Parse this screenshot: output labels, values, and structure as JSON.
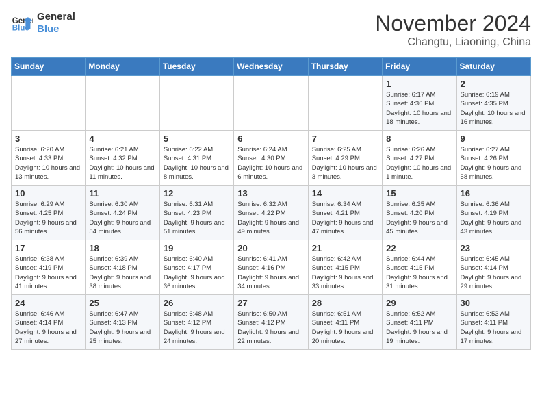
{
  "logo": {
    "line1": "General",
    "line2": "Blue"
  },
  "title": "November 2024",
  "location": "Changtu, Liaoning, China",
  "days_of_week": [
    "Sunday",
    "Monday",
    "Tuesday",
    "Wednesday",
    "Thursday",
    "Friday",
    "Saturday"
  ],
  "weeks": [
    [
      {
        "day": "",
        "info": ""
      },
      {
        "day": "",
        "info": ""
      },
      {
        "day": "",
        "info": ""
      },
      {
        "day": "",
        "info": ""
      },
      {
        "day": "",
        "info": ""
      },
      {
        "day": "1",
        "info": "Sunrise: 6:17 AM\nSunset: 4:36 PM\nDaylight: 10 hours and 18 minutes."
      },
      {
        "day": "2",
        "info": "Sunrise: 6:19 AM\nSunset: 4:35 PM\nDaylight: 10 hours and 16 minutes."
      }
    ],
    [
      {
        "day": "3",
        "info": "Sunrise: 6:20 AM\nSunset: 4:33 PM\nDaylight: 10 hours and 13 minutes."
      },
      {
        "day": "4",
        "info": "Sunrise: 6:21 AM\nSunset: 4:32 PM\nDaylight: 10 hours and 11 minutes."
      },
      {
        "day": "5",
        "info": "Sunrise: 6:22 AM\nSunset: 4:31 PM\nDaylight: 10 hours and 8 minutes."
      },
      {
        "day": "6",
        "info": "Sunrise: 6:24 AM\nSunset: 4:30 PM\nDaylight: 10 hours and 6 minutes."
      },
      {
        "day": "7",
        "info": "Sunrise: 6:25 AM\nSunset: 4:29 PM\nDaylight: 10 hours and 3 minutes."
      },
      {
        "day": "8",
        "info": "Sunrise: 6:26 AM\nSunset: 4:27 PM\nDaylight: 10 hours and 1 minute."
      },
      {
        "day": "9",
        "info": "Sunrise: 6:27 AM\nSunset: 4:26 PM\nDaylight: 9 hours and 58 minutes."
      }
    ],
    [
      {
        "day": "10",
        "info": "Sunrise: 6:29 AM\nSunset: 4:25 PM\nDaylight: 9 hours and 56 minutes."
      },
      {
        "day": "11",
        "info": "Sunrise: 6:30 AM\nSunset: 4:24 PM\nDaylight: 9 hours and 54 minutes."
      },
      {
        "day": "12",
        "info": "Sunrise: 6:31 AM\nSunset: 4:23 PM\nDaylight: 9 hours and 51 minutes."
      },
      {
        "day": "13",
        "info": "Sunrise: 6:32 AM\nSunset: 4:22 PM\nDaylight: 9 hours and 49 minutes."
      },
      {
        "day": "14",
        "info": "Sunrise: 6:34 AM\nSunset: 4:21 PM\nDaylight: 9 hours and 47 minutes."
      },
      {
        "day": "15",
        "info": "Sunrise: 6:35 AM\nSunset: 4:20 PM\nDaylight: 9 hours and 45 minutes."
      },
      {
        "day": "16",
        "info": "Sunrise: 6:36 AM\nSunset: 4:19 PM\nDaylight: 9 hours and 43 minutes."
      }
    ],
    [
      {
        "day": "17",
        "info": "Sunrise: 6:38 AM\nSunset: 4:19 PM\nDaylight: 9 hours and 41 minutes."
      },
      {
        "day": "18",
        "info": "Sunrise: 6:39 AM\nSunset: 4:18 PM\nDaylight: 9 hours and 38 minutes."
      },
      {
        "day": "19",
        "info": "Sunrise: 6:40 AM\nSunset: 4:17 PM\nDaylight: 9 hours and 36 minutes."
      },
      {
        "day": "20",
        "info": "Sunrise: 6:41 AM\nSunset: 4:16 PM\nDaylight: 9 hours and 34 minutes."
      },
      {
        "day": "21",
        "info": "Sunrise: 6:42 AM\nSunset: 4:15 PM\nDaylight: 9 hours and 33 minutes."
      },
      {
        "day": "22",
        "info": "Sunrise: 6:44 AM\nSunset: 4:15 PM\nDaylight: 9 hours and 31 minutes."
      },
      {
        "day": "23",
        "info": "Sunrise: 6:45 AM\nSunset: 4:14 PM\nDaylight: 9 hours and 29 minutes."
      }
    ],
    [
      {
        "day": "24",
        "info": "Sunrise: 6:46 AM\nSunset: 4:14 PM\nDaylight: 9 hours and 27 minutes."
      },
      {
        "day": "25",
        "info": "Sunrise: 6:47 AM\nSunset: 4:13 PM\nDaylight: 9 hours and 25 minutes."
      },
      {
        "day": "26",
        "info": "Sunrise: 6:48 AM\nSunset: 4:12 PM\nDaylight: 9 hours and 24 minutes."
      },
      {
        "day": "27",
        "info": "Sunrise: 6:50 AM\nSunset: 4:12 PM\nDaylight: 9 hours and 22 minutes."
      },
      {
        "day": "28",
        "info": "Sunrise: 6:51 AM\nSunset: 4:11 PM\nDaylight: 9 hours and 20 minutes."
      },
      {
        "day": "29",
        "info": "Sunrise: 6:52 AM\nSunset: 4:11 PM\nDaylight: 9 hours and 19 minutes."
      },
      {
        "day": "30",
        "info": "Sunrise: 6:53 AM\nSunset: 4:11 PM\nDaylight: 9 hours and 17 minutes."
      }
    ]
  ]
}
